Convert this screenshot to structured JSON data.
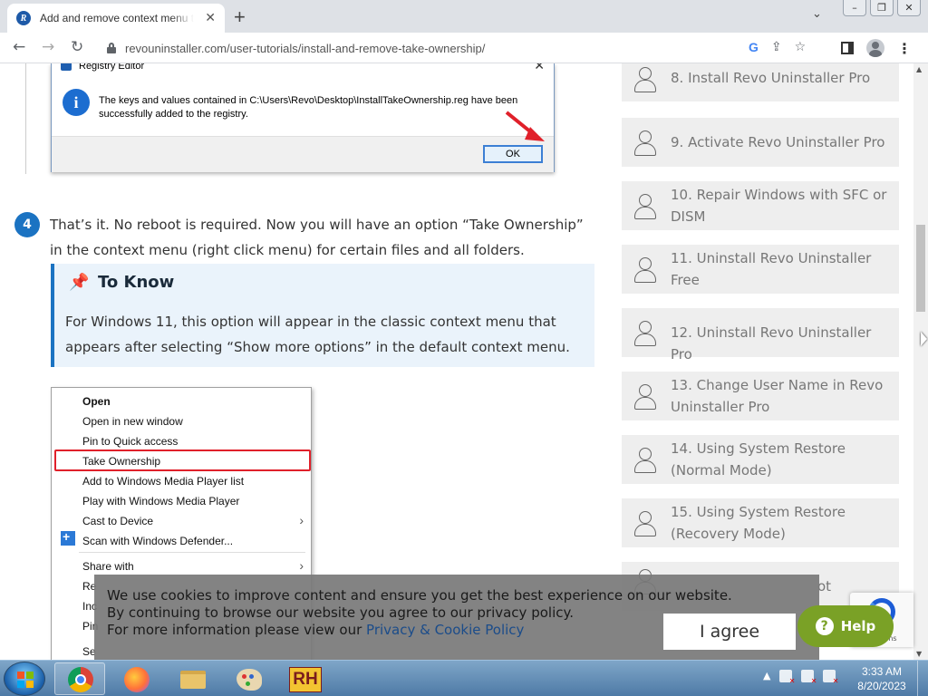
{
  "browser": {
    "tab_title": "Add and remove context menu to",
    "url": "revouninstaller.com/user-tutorials/install-and-remove-take-ownership/",
    "favicon_letter": "R"
  },
  "registry_dialog": {
    "title": "Registry Editor",
    "message": "The keys and values contained in C:\\Users\\Revo\\Desktop\\InstallTakeOwnership.reg have been successfully added to the registry.",
    "ok_label": "OK"
  },
  "step": {
    "number": "4",
    "text": "That’s it. No reboot is required. Now you will have an option “Take Ownership” in the context menu (right click menu) for certain files and all folders."
  },
  "to_know": {
    "title": "To Know",
    "text": "For Windows 11, this option will appear in the classic context menu that appears after selecting “Show more options” in the default context menu."
  },
  "context_menu": {
    "items": [
      {
        "label": "Open",
        "bold": true
      },
      {
        "label": "Open in new window"
      },
      {
        "label": "Pin to Quick access"
      },
      {
        "label": "Take Ownership"
      },
      {
        "label": "Add to Windows Media Player list"
      },
      {
        "label": "Play with Windows Media Player"
      },
      {
        "label": "Cast to Device"
      },
      {
        "label": "Scan with Windows Defender..."
      },
      {
        "label": "Share with"
      },
      {
        "label": "Re"
      },
      {
        "label": "Inc"
      },
      {
        "label": "Pin"
      },
      {
        "label": "Se"
      }
    ]
  },
  "sidebar": {
    "items": [
      {
        "label": "8. Install Revo Uninstaller Pro"
      },
      {
        "label": "9. Activate Revo Uninstaller Pro"
      },
      {
        "label": "10. Repair Windows with SFC or DISM"
      },
      {
        "label": "11. Uninstall Revo Uninstaller Free"
      },
      {
        "label": "12. Uninstall Revo Uninstaller Pro"
      },
      {
        "label": "13. Change User Name in Revo Uninstaller Pro"
      },
      {
        "label": "14. Using System Restore (Normal Mode)"
      },
      {
        "label": "15. Using System Restore (Recovery Mode)"
      },
      {
        "label": "ot"
      }
    ]
  },
  "cookie": {
    "line1": "We use cookies to improve content and ensure you get the best experience on our website.",
    "line2": "By continuing to browse our website you agree to our privacy policy.",
    "line3_prefix": "For more information please view our ",
    "link": "Privacy & Cookie Policy",
    "agree": "I agree"
  },
  "help": {
    "label": "Help"
  },
  "recaptcha": {
    "terms": "Terms"
  },
  "taskbar": {
    "time": "3:33 AM",
    "date": "8/20/2023",
    "rh_label": "RH"
  },
  "colors": {
    "accent_blue": "#1b73c2",
    "highlight_red": "#e0202a",
    "help_green": "#7aa126"
  }
}
